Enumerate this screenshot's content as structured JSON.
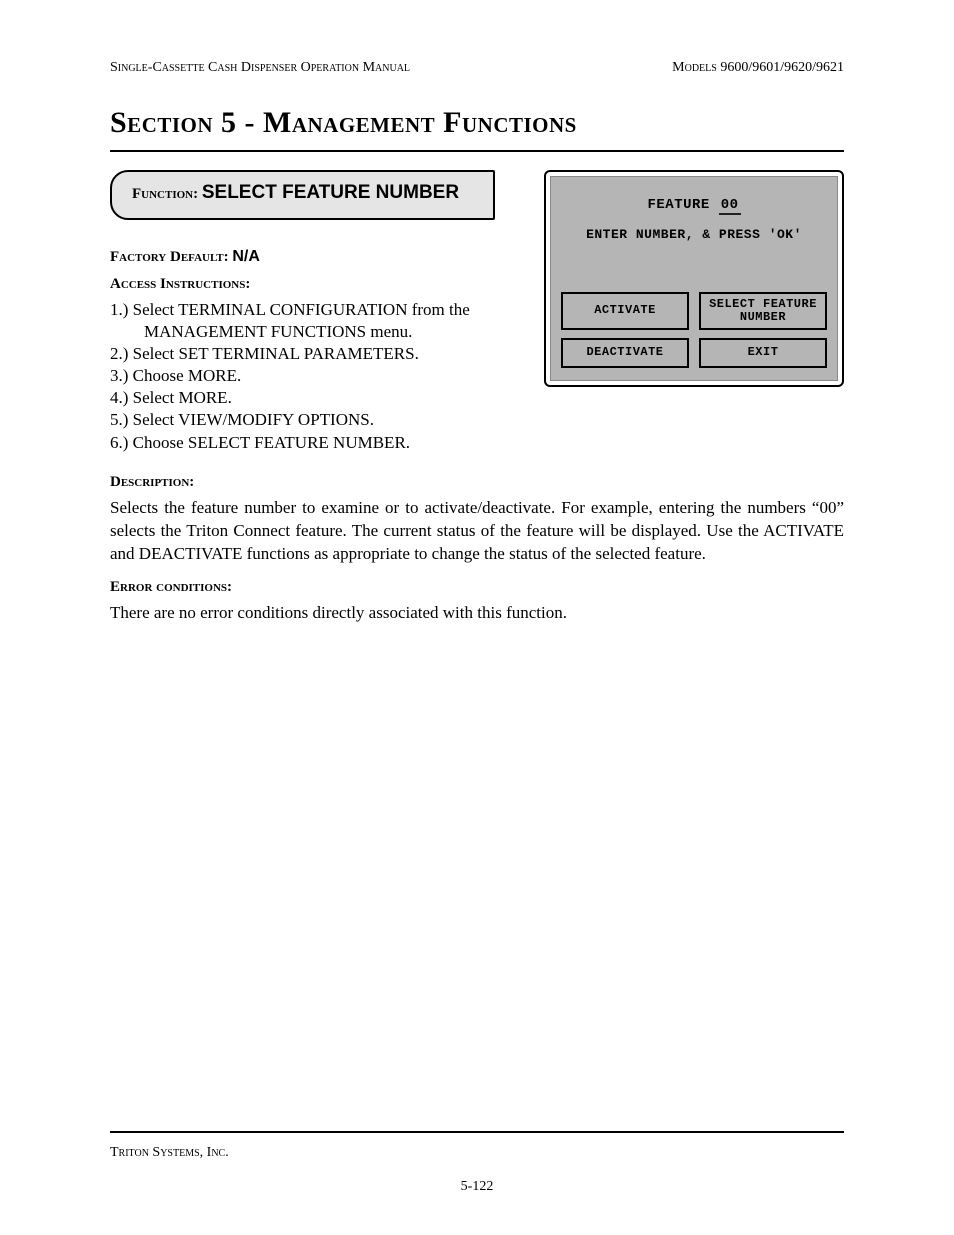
{
  "header": {
    "left": "Single-Cassette Cash Dispenser Operation Manual",
    "right": "Models 9600/9601/9620/9621"
  },
  "section_title": "Section 5 - Management Functions",
  "function_tab": {
    "label": "Function:  ",
    "name": "SELECT FEATURE NUMBER"
  },
  "factory_default": {
    "label": "Factory Default: ",
    "value": "N/A"
  },
  "access": {
    "label": "Access Instructions:",
    "steps": [
      "1.)  Select TERMINAL CONFIGURATION from the MANAGEMENT FUNCTIONS menu.",
      "2.)  Select SET TERMINAL PARAMETERS.",
      "3.)  Choose MORE.",
      "4.)  Select MORE.",
      "5.)  Select VIEW/MODIFY OPTIONS.",
      "6.)  Choose SELECT FEATURE NUMBER."
    ]
  },
  "description": {
    "label": "Description:",
    "text": "Selects the feature number to examine or to activate/deactivate.  For example, entering the numbers “00” selects the Triton Connect feature. The current status of the feature will be displayed. Use the ACTIVATE and DEACTIVATE functions as appropriate to change the status of the selected feature."
  },
  "error": {
    "label": "Error conditions:",
    "text": "There are no error conditions directly associated with this function."
  },
  "screen": {
    "feature_label": "FEATURE ",
    "feature_value": "00",
    "prompt": "ENTER NUMBER, & PRESS 'OK'",
    "buttons": {
      "activate": "ACTIVATE",
      "select_feature": "SELECT FEATURE\nNUMBER",
      "deactivate": "DEACTIVATE",
      "exit": "EXIT"
    }
  },
  "footer": {
    "company": "Triton Systems, Inc.",
    "page": "5-122"
  }
}
